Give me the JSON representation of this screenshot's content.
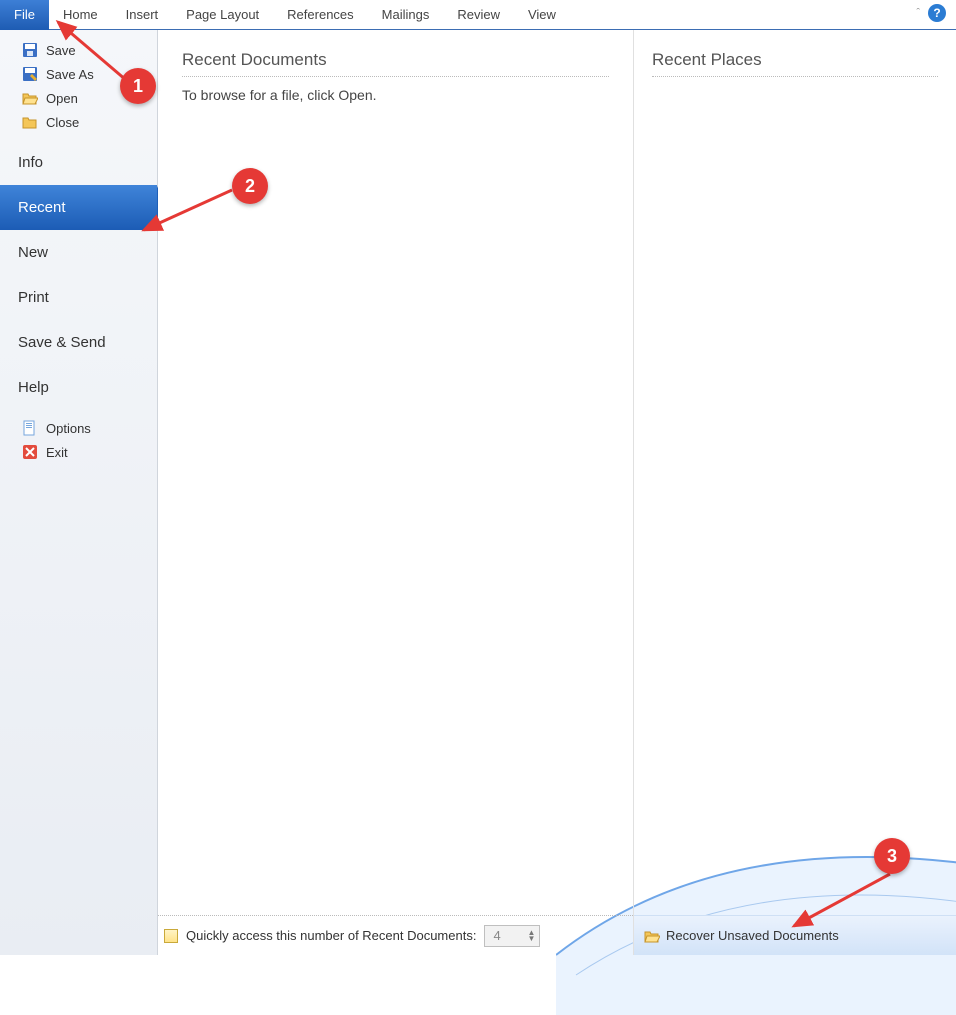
{
  "ribbon": {
    "tabs": [
      "File",
      "Home",
      "Insert",
      "Page Layout",
      "References",
      "Mailings",
      "Review",
      "View"
    ]
  },
  "sidebar": {
    "save": "Save",
    "save_as": "Save As",
    "open": "Open",
    "close_label": "Close",
    "info": "Info",
    "recent": "Recent",
    "new": "New",
    "print": "Print",
    "save_send": "Save & Send",
    "help": "Help",
    "options": "Options",
    "exit": "Exit"
  },
  "recent_docs": {
    "heading": "Recent Documents",
    "empty_text": "To browse for a file, click Open."
  },
  "recent_places": {
    "heading": "Recent Places"
  },
  "footer": {
    "quick_access_label": "Quickly access this number of Recent Documents:",
    "quick_access_value": "4",
    "recover_label": "Recover Unsaved Documents"
  },
  "annotations": {
    "b1": "1",
    "b2": "2",
    "b3": "3"
  }
}
